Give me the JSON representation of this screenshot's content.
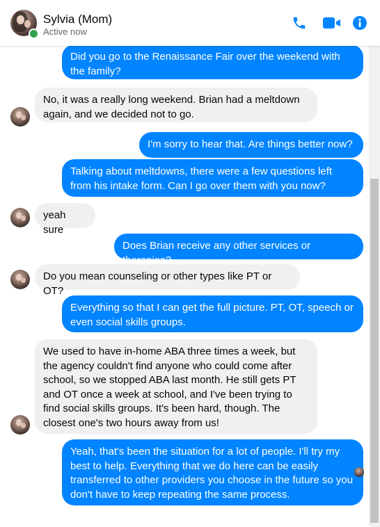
{
  "header": {
    "name": "Sylvia (Mom)",
    "status": "Active now",
    "icons": [
      "phone-icon",
      "video-camera-icon",
      "info-icon"
    ],
    "accent_color": "#0084ff",
    "active_color": "#31a24c"
  },
  "messages": [
    {
      "from": "me",
      "text": "Did you go to the Renaissance Fair over the weekend with the family?"
    },
    {
      "from": "contact",
      "text": "No, it was a really long weekend.  Brian had a meltdown again, and we decided not to go."
    },
    {
      "from": "me",
      "text": "I'm sorry to hear that. Are things better now?"
    },
    {
      "from": "me",
      "text": "Talking about meltdowns, there were a few questions left from his intake form. Can I go over them with you now?"
    },
    {
      "from": "contact",
      "text": "yeah sure"
    },
    {
      "from": "me",
      "text": "Does Brian receive any other services or therapies?"
    },
    {
      "from": "contact",
      "text": "Do you mean counseling or other types like PT or OT?"
    },
    {
      "from": "me",
      "text": "Everything so that I can get the full picture.  PT, OT, speech or even social skills groups."
    },
    {
      "from": "contact",
      "text": "We used to have in-home ABA three times a week, but the agency couldn't find anyone who could come after school, so we stopped ABA last month.  He still gets PT and OT once a week at school, and I've been trying to find social skills groups.  It's been hard, though.  The closest one's two hours away from us!"
    },
    {
      "from": "me",
      "text": "Yeah, that's been the situation for a lot of people.  I'll try my best to help.  Everything that we do here can be easily transferred to other providers you choose in the future so you don't have to keep repeating the same process."
    }
  ],
  "colors": {
    "outgoing_bubble": "#0084ff",
    "incoming_bubble": "#f0f0f0"
  }
}
